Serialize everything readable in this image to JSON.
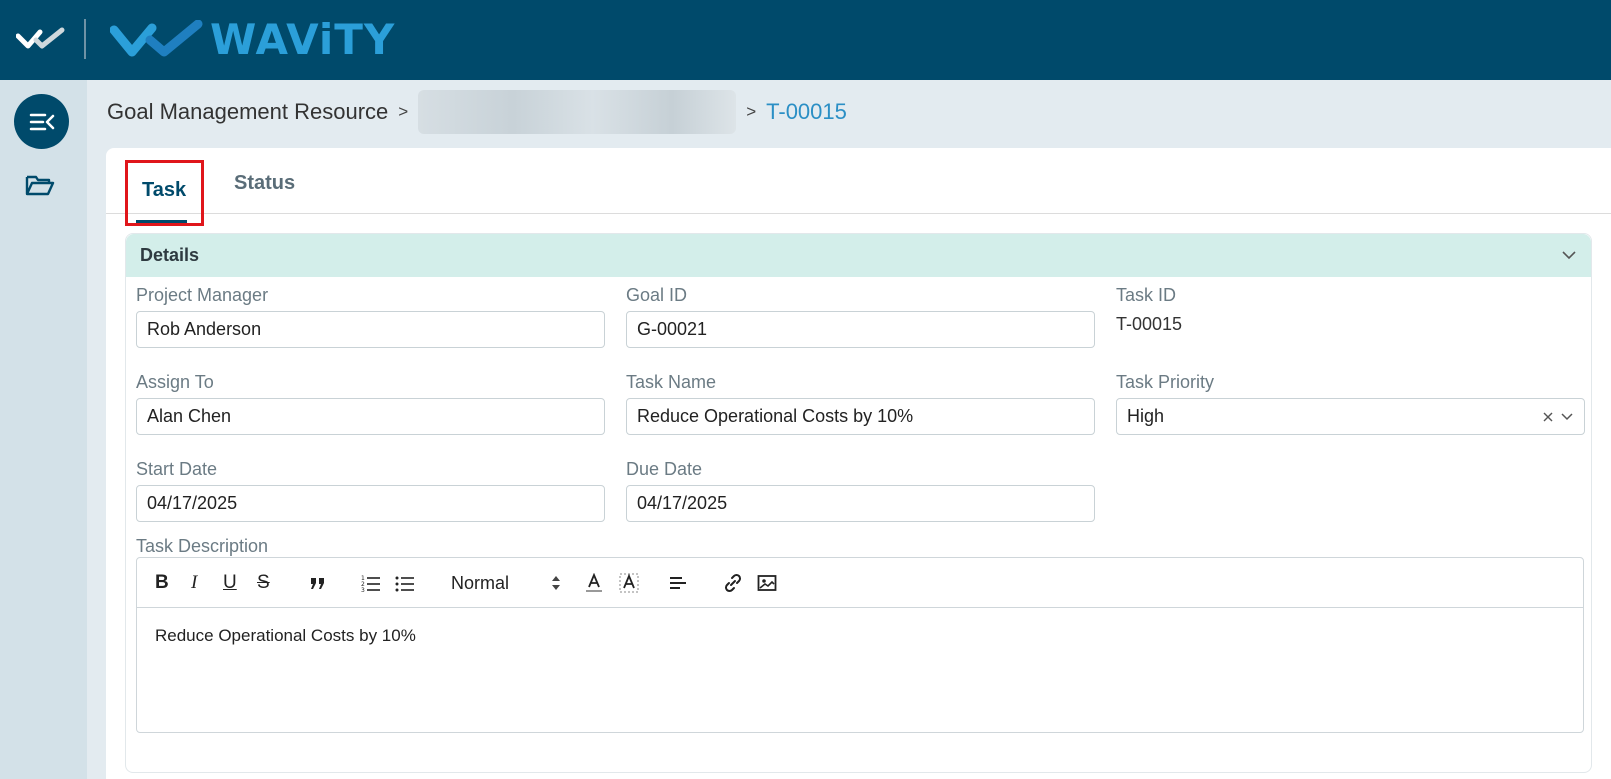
{
  "header": {
    "brand": "WAViTY",
    "small_logo_icon": "checkmarks-logo-icon"
  },
  "sidebar": {
    "toggle_icon": "collapse-menu-icon",
    "folder_icon": "folder-open-icon"
  },
  "breadcrumb": {
    "root": "Goal Management Resource",
    "separator": ">",
    "current": "T-00015"
  },
  "tabs": [
    {
      "label": "Task",
      "active": true
    },
    {
      "label": "Status",
      "active": false
    }
  ],
  "details": {
    "title": "Details",
    "project_manager": {
      "label": "Project Manager",
      "value": "Rob Anderson"
    },
    "goal_id": {
      "label": "Goal ID",
      "value": "G-00021"
    },
    "task_id": {
      "label": "Task ID",
      "value": "T-00015"
    },
    "assign_to": {
      "label": "Assign To",
      "value": "Alan Chen"
    },
    "task_name": {
      "label": "Task Name",
      "value": "Reduce Operational Costs by 10%"
    },
    "task_priority": {
      "label": "Task Priority",
      "value": "High"
    },
    "start_date": {
      "label": "Start Date",
      "value": "04/17/2025"
    },
    "due_date": {
      "label": "Due Date",
      "value": "04/17/2025"
    },
    "task_description": {
      "label": "Task Description",
      "format_select": "Normal",
      "body": "Reduce Operational Costs by 10%"
    }
  },
  "colors": {
    "topbar": "#004a6b",
    "brand": "#2b9fd9",
    "panel_header": "#d3eeea",
    "highlight_border": "#e0161b",
    "link": "#2b8fc5"
  }
}
